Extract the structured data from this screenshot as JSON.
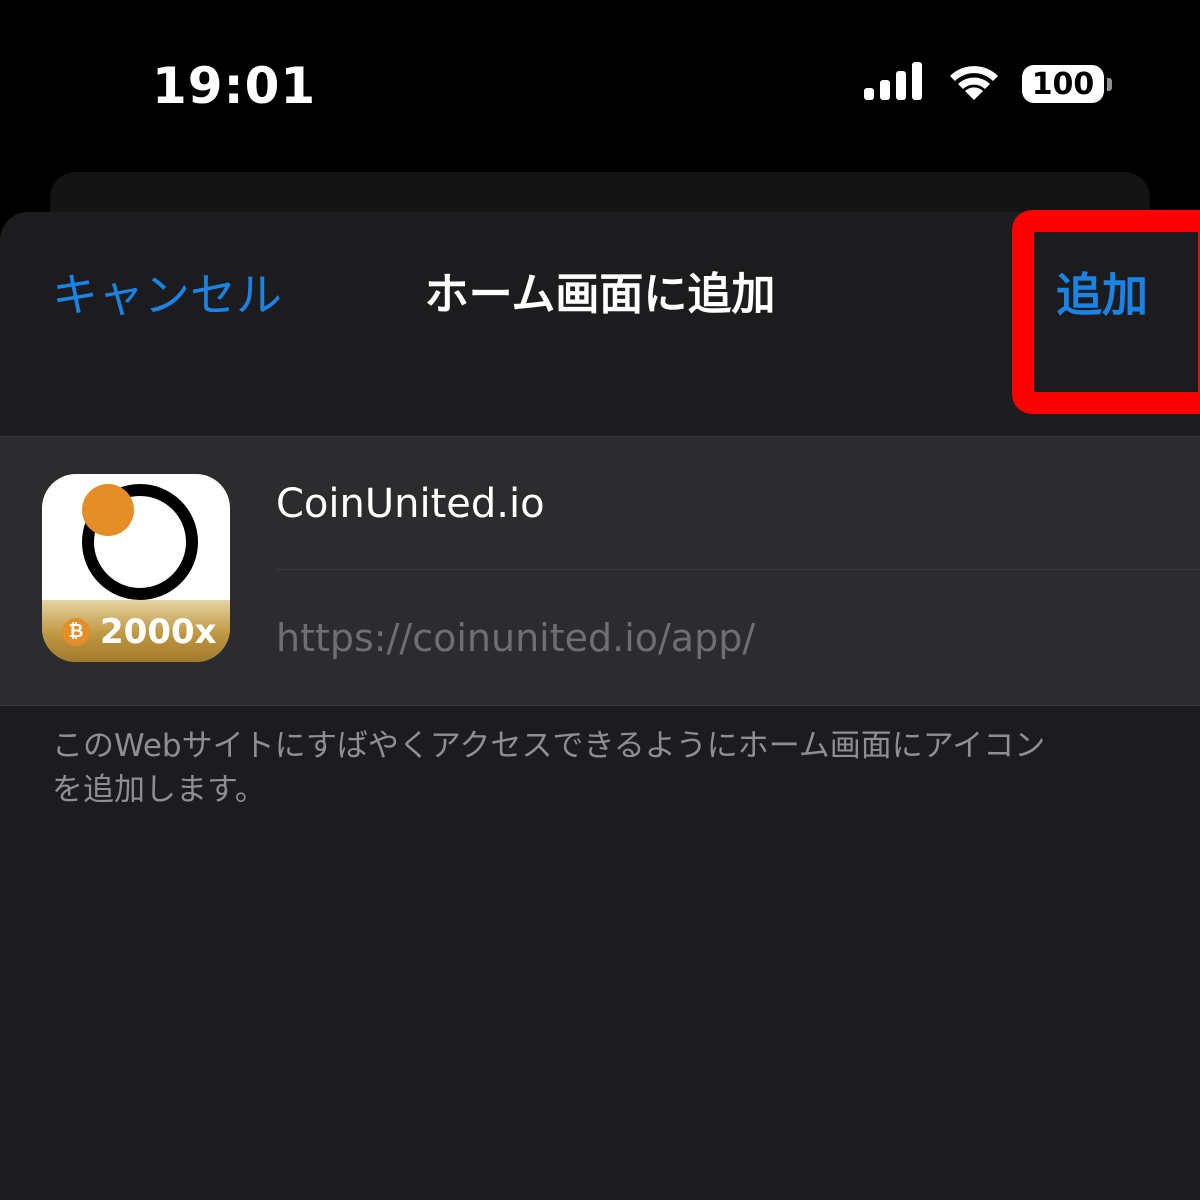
{
  "status_bar": {
    "time": "19:01",
    "battery": "100",
    "icons": [
      "signal-icon",
      "wifi-icon",
      "battery-icon"
    ]
  },
  "nav": {
    "cancel_label": "キャンセル",
    "title": "ホーム画面に追加",
    "add_label": "追加"
  },
  "app": {
    "icon_label": "2000x",
    "coin_symbol": "₿",
    "name": "CoinUnited.io",
    "url": "https://coinunited.io/app/"
  },
  "footnote": "このWebサイトにすばやくアクセスできるようにホーム画面にアイコンを追加します。",
  "colors": {
    "accent": "#1a84e6",
    "highlight": "#ff0000",
    "sheet_bg": "#1c1c1e",
    "group_bg": "#2c2c2e",
    "icon_orange": "#e58d26"
  }
}
